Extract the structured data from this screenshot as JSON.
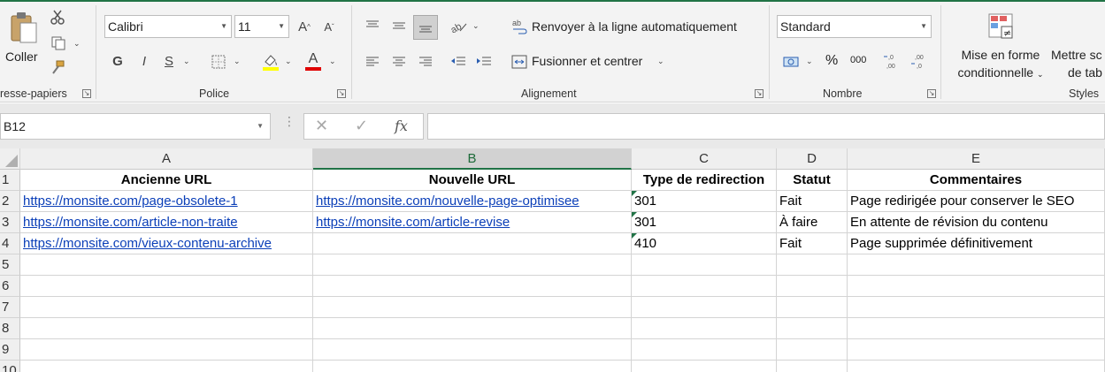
{
  "ribbon": {
    "clipboard": {
      "paste_label": "Coller",
      "group_label": "resse-papiers"
    },
    "font": {
      "font_name": "Calibri",
      "font_size": "11",
      "bold_label": "G",
      "italic_label": "I",
      "underline_label": "S",
      "grow_label": "A",
      "shrink_label": "A",
      "font_color_label": "A",
      "highlight_color": "#ffff00",
      "font_color": "#e00000",
      "group_label": "Police"
    },
    "alignment": {
      "wrap_label": "Renvoyer à la ligne automatiquement",
      "merge_label": "Fusionner et centrer",
      "group_label": "Alignement"
    },
    "number": {
      "format": "Standard",
      "percent_label": "%",
      "thousands_label": "000",
      "group_label": "Nombre"
    },
    "styles": {
      "conditional_line1": "Mise en forme",
      "conditional_line2": "conditionnelle",
      "table_line1": "Mettre sc",
      "table_line2": "de tab",
      "group_label": "Styles"
    }
  },
  "formula_bar": {
    "name_box": "B12",
    "fx_label": "fx",
    "formula": ""
  },
  "sheet": {
    "accent": "#217346",
    "columns": [
      "A",
      "B",
      "C",
      "D",
      "E"
    ],
    "selected_column": "B",
    "rows": [
      "1",
      "2",
      "3",
      "4",
      "5",
      "6",
      "7",
      "8",
      "9",
      "10"
    ],
    "cells": {
      "A1": "Ancienne URL",
      "B1": "Nouvelle URL",
      "C1": "Type de redirection",
      "D1": "Statut",
      "E1": "Commentaires",
      "A2": "https://monsite.com/page-obsolete-1",
      "B2": "https://monsite.com/nouvelle-page-optimisee",
      "C2": "301",
      "D2": "Fait",
      "E2": "Page redirigée pour conserver le SEO",
      "A3": "https://monsite.com/article-non-traite",
      "B3": "https://monsite.com/article-revise",
      "C3": "301",
      "D3": "À faire",
      "E3": "En attente de révision du contenu",
      "A4": "https://monsite.com/vieux-contenu-archive",
      "B4": "",
      "C4": "410",
      "D4": "Fait",
      "E4": "Page supprimée définitivement"
    }
  }
}
